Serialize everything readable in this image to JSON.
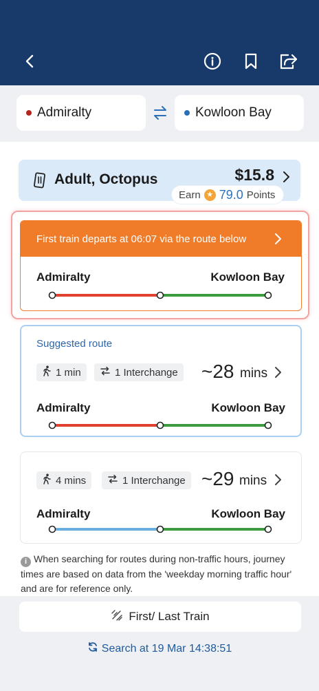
{
  "header": {
    "icons": [
      "back-icon",
      "info-icon",
      "bookmark-icon",
      "share-icon"
    ]
  },
  "stations": {
    "origin": "Admiralty",
    "destination": "Kowloon Bay",
    "origin_color": "#b3261e",
    "destination_color": "#2a6fb8"
  },
  "fare": {
    "type": "Adult, Octopus",
    "price": "$15.8",
    "earn_label": "Earn",
    "points": "79.0",
    "points_label": "Points"
  },
  "first_train": {
    "banner": "First train departs at 06:07 via the route below",
    "from": "Admiralty",
    "to": "Kowloon Bay",
    "segments": [
      "#e0402f",
      "#3c9a3f"
    ]
  },
  "routes": [
    {
      "label": "Suggested route",
      "walk": "1 min",
      "interchange": "1 Interchange",
      "approx": "~28",
      "unit": "mins",
      "from": "Admiralty",
      "to": "Kowloon Bay",
      "segments": [
        "#e0402f",
        "#3c9a3f"
      ]
    },
    {
      "walk": "4 mins",
      "interchange": "1 Interchange",
      "approx": "~29",
      "unit": "mins",
      "from": "Admiralty",
      "to": "Kowloon Bay",
      "segments": [
        "#6aaee0",
        "#3c9a3f"
      ]
    }
  ],
  "note": "When searching for routes during non-traffic hours, journey times are based on data from the 'weekday morning traffic hour' and are for reference only.",
  "bottom": {
    "first_last_label": "First/ Last Train",
    "search_at": "Search at 19 Mar 14:38:51"
  },
  "colors": {
    "header_bg": "#173a6b",
    "accent_orange": "#f07c2a",
    "suggest_border": "#a9d0f2"
  }
}
